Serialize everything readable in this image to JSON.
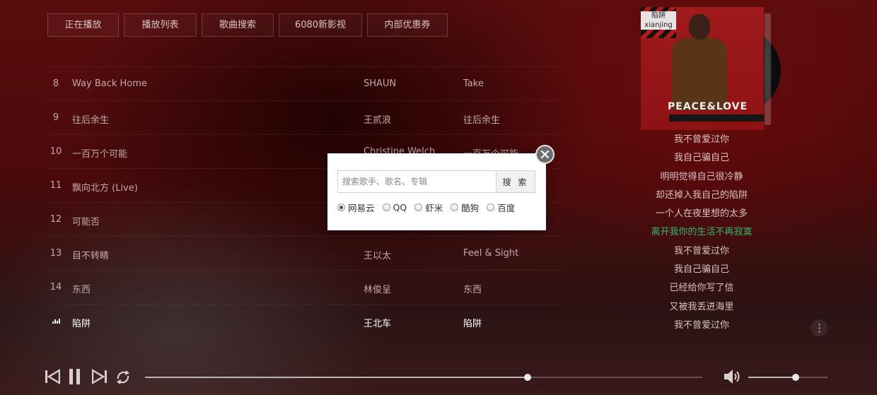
{
  "nav": {
    "tabs": [
      "正在播放",
      "播放列表",
      "歌曲搜索",
      "6080新影视",
      "内部优惠券"
    ]
  },
  "playlist": {
    "rows": [
      {
        "num": "8",
        "name": "Way Back Home",
        "artist": "SHAUN",
        "album": "Take"
      },
      {
        "num": "9",
        "name": "往后余生",
        "artist": "王贰浪",
        "album": "往后余生"
      },
      {
        "num": "10",
        "name": "一百万个可能",
        "artist": "Christine Welch",
        "album": "一百万个可能"
      },
      {
        "num": "11",
        "name": "飘向北方 (Live)",
        "artist": "",
        "album": ""
      },
      {
        "num": "12",
        "name": "可能否",
        "artist": "",
        "album": ""
      },
      {
        "num": "13",
        "name": "目不转睛",
        "artist": "王以太",
        "album": "Feel & Sight"
      },
      {
        "num": "14",
        "name": "东西",
        "artist": "林俊呈",
        "album": "东西"
      },
      {
        "num": "",
        "name": "陷阱",
        "artist": "王北车",
        "album": "陷阱",
        "playing": true
      }
    ]
  },
  "cover": {
    "tag_line1": "陷阱",
    "tag_line2": "xianjing",
    "title_text": "PEACE&LOVE"
  },
  "lyrics": {
    "lines": [
      "我不曾爱过你",
      "我自己骗自己",
      "明明觉得自己很冷静",
      "却还掉入我自己的陷阱",
      "一个人在夜里想的太多",
      "离开我你的生活不再寂寞",
      "我不曾爱过你",
      "我自己骗自己",
      "已经给你写了信",
      "又被我丢进海里",
      "我不曾爱过你"
    ],
    "active_index": 5,
    "active_color": "#3bb36b"
  },
  "player": {
    "progress": 0.687,
    "volume": 0.6
  },
  "search_modal": {
    "placeholder": "搜索歌手、歌名、专辑",
    "button_label": "搜 索",
    "sources": [
      "网易云",
      "QQ",
      "虾米",
      "酷狗",
      "百度"
    ],
    "selected_index": 0
  },
  "icons": [
    "prev-icon",
    "pause-icon",
    "next-icon",
    "loop-icon",
    "volume-icon",
    "close-icon",
    "more-icon",
    "playing-icon"
  ]
}
